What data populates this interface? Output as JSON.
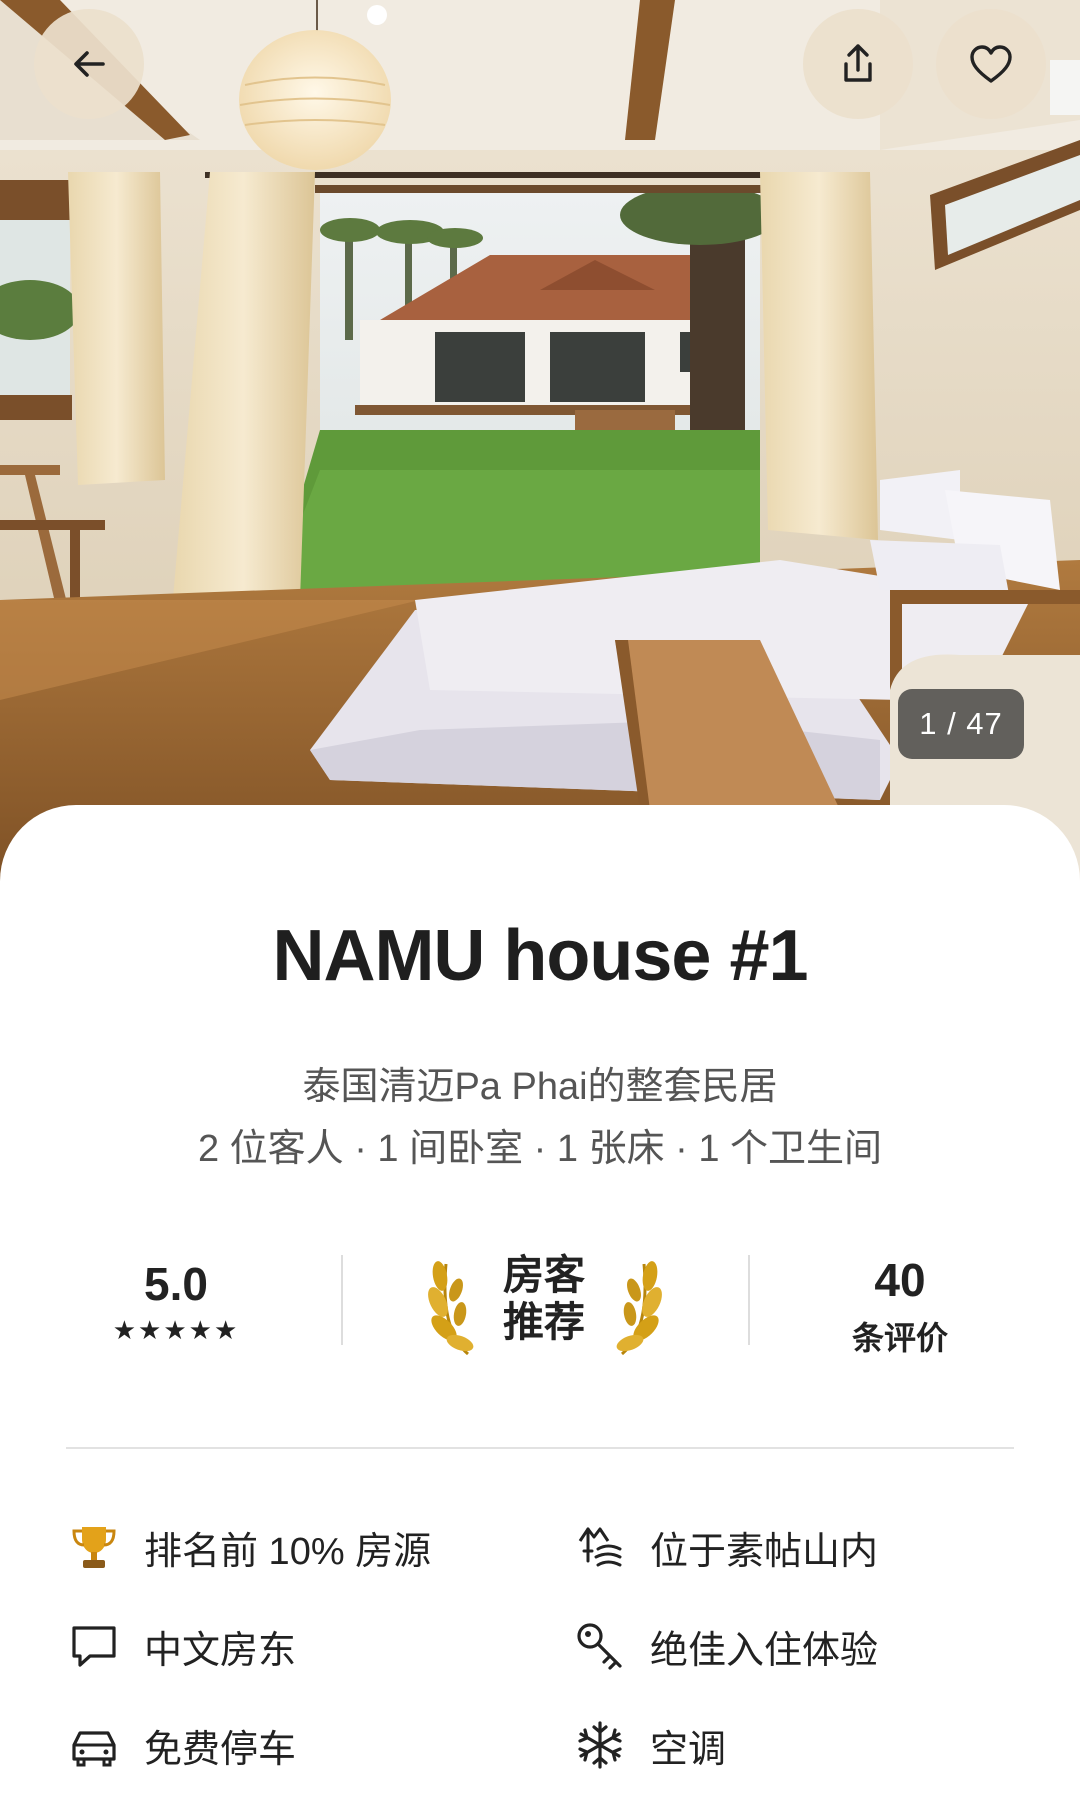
{
  "hero": {
    "photo_counter": "1 / 47"
  },
  "listing": {
    "title": "NAMU house #1",
    "subtitle_line1": "泰国清迈Pa Phai的整套民居",
    "subtitle_line2": "2 位客人 · 1 间卧室 · 1 张床 · 1 个卫生间"
  },
  "stats": {
    "rating": "5.0",
    "stars": "★★★★★",
    "star_count": 5,
    "badge_line1": "房客",
    "badge_line2": "推荐",
    "review_count": "40",
    "review_label": "条评价"
  },
  "features": [
    {
      "icon": "trophy-icon",
      "label": "排名前 10% 房源"
    },
    {
      "icon": "mountain-icon",
      "label": "位于素帖山内"
    },
    {
      "icon": "chat-bubble-icon",
      "label": "中文房东"
    },
    {
      "icon": "key-icon",
      "label": "绝佳入住体验"
    },
    {
      "icon": "car-icon",
      "label": "免费停车"
    },
    {
      "icon": "snowflake-icon",
      "label": "空调"
    }
  ],
  "colors": {
    "button_bg": "#ece0cc",
    "laurel_gold": "#d4a017",
    "trophy_gold": "#e3a21a",
    "text_primary": "#222222",
    "text_secondary": "#555555"
  }
}
